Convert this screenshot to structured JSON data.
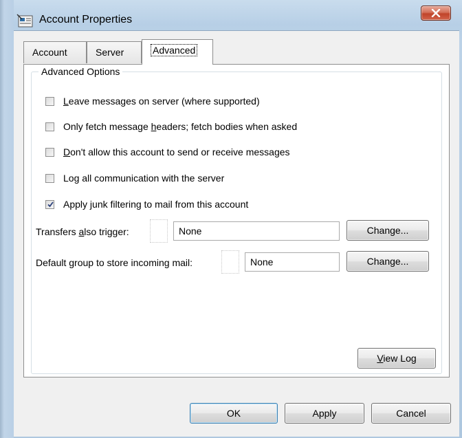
{
  "window": {
    "title": "Account Properties",
    "close_symbol": "X"
  },
  "tabs": [
    {
      "label": "Account",
      "active": false
    },
    {
      "label": "Server",
      "active": false
    },
    {
      "label": "Advanced",
      "active": true
    }
  ],
  "advanced": {
    "group_title": "Advanced Options",
    "options": [
      {
        "pre": "",
        "key": "L",
        "post": "eave messages on server (where supported)",
        "checked": false
      },
      {
        "pre": "Only fetch message ",
        "key": "h",
        "post": "eaders; fetch bodies when asked",
        "checked": false
      },
      {
        "pre": "",
        "key": "D",
        "post": "on't allow this account to send or receive messages",
        "checked": false
      },
      {
        "pre": "Lo",
        "key": "g",
        "post": " all communication with the server",
        "checked": false
      },
      {
        "pre": "Apply ",
        "key": "j",
        "post": "unk filtering to mail from this account",
        "checked": true
      }
    ],
    "transfers": {
      "pre": "Transfers ",
      "key": "a",
      "post": "lso trigger:",
      "value": "None",
      "button": "Change..."
    },
    "default_group": {
      "pre": "Default ",
      "key": "g",
      "post": "roup to store incoming mail:",
      "value": "None",
      "button": "Change..."
    },
    "view_log": {
      "key": "V",
      "post": "iew Log"
    }
  },
  "footer": {
    "ok": "OK",
    "apply": "Apply",
    "cancel": "Cancel"
  }
}
